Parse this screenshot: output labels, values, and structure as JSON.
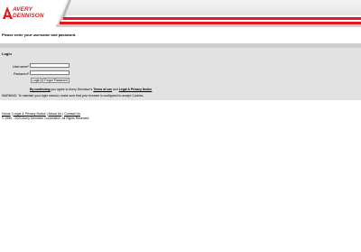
{
  "brand": {
    "line1": "AVERY",
    "line2": "DENNISON",
    "color": "#e01a22"
  },
  "intro_text": "Please enter your username and password.",
  "login": {
    "title": "Login",
    "username_label": "Username*",
    "password_label": "Password*",
    "login_button": "Login",
    "forgot_button": "Forgot Password",
    "agree_prefix": "By continuing",
    "agree_middle": " you agree to Avery Dennison's ",
    "terms_link": "Terms of use",
    "agree_and": " and ",
    "privacy_link": "Legal & Privacy Notice",
    "warning": "WARNING: To maintain your login session, make sure that your browser is configured to accept Cookies."
  },
  "footer": {
    "links": [
      "Home",
      "Legal & Privacy Notice",
      "About Us",
      "Contact Us"
    ],
    "separator": " | ",
    "copyright": "© 1996 - 2023 Avery Dennison Corporation. All Rights Reserved."
  }
}
